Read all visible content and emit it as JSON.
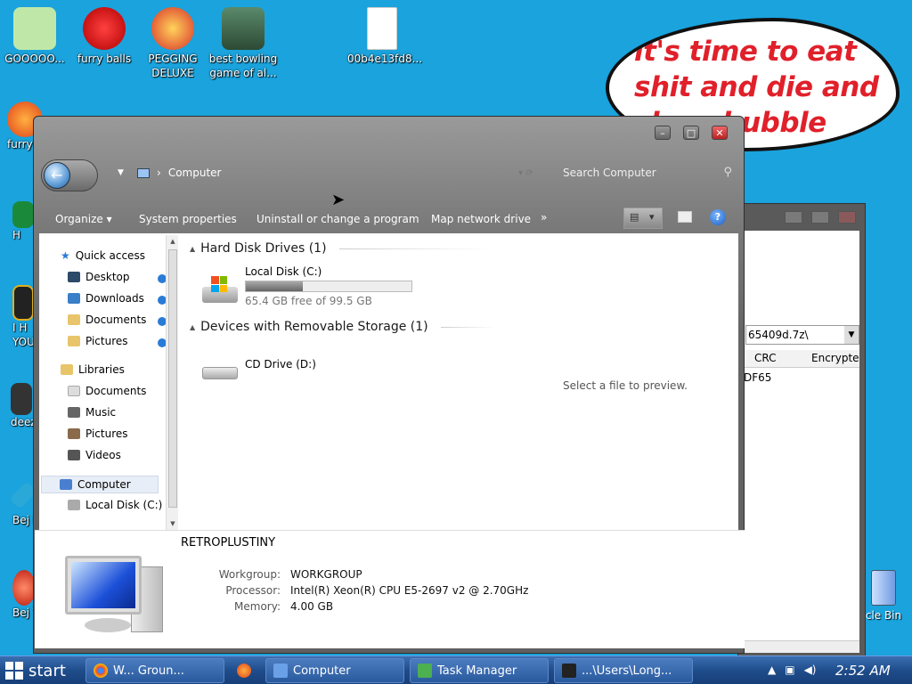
{
  "desktop": {
    "icons": [
      {
        "label": "GOOOOO...",
        "color": "#bfe8a8"
      },
      {
        "label": "furry balls",
        "color": "#e02020"
      },
      {
        "label": "PEGGING DELUXE",
        "color": "#d8302a"
      },
      {
        "label": "best bowling game of al...",
        "color": "#3d6a4a"
      },
      {
        "label": "00b4e13fd8...",
        "color": "#ffffff"
      },
      {
        "label": "furry",
        "color": "#f06a1f"
      },
      {
        "label": "H",
        "color": "#1a8a3a"
      },
      {
        "label": "I H YOU",
        "color": "#222222"
      },
      {
        "label": "deez",
        "color": "#333333"
      },
      {
        "label": "Bej De",
        "color": "#2aa8d8"
      },
      {
        "label": "Bej Tw",
        "color": "#d83020"
      },
      {
        "label": "cle Bin",
        "color": "#9bbcf0"
      }
    ],
    "bubble_text": "it's time to eat shit and die and chew bubble gum"
  },
  "bg_window": {
    "path": "65409d.7z\\",
    "columns": [
      "CRC",
      "Encrypte"
    ],
    "row_crc": "DF65"
  },
  "explorer": {
    "address": "Computer",
    "search_placeholder": "Search Computer",
    "toolbar": {
      "organize": "Organize",
      "system_properties": "System properties",
      "uninstall": "Uninstall or change a program",
      "map_network": "Map network drive",
      "more": "»"
    },
    "nav": {
      "quick_access": "Quick access",
      "desktop": "Desktop",
      "downloads": "Downloads",
      "documents": "Documents",
      "pictures": "Pictures",
      "libraries": "Libraries",
      "lib_documents": "Documents",
      "lib_music": "Music",
      "lib_pictures": "Pictures",
      "lib_videos": "Videos",
      "computer": "Computer",
      "local_disk": "Local Disk (C:)"
    },
    "groups": {
      "hdd": "Hard Disk Drives (1)",
      "removable": "Devices with Removable Storage (1)"
    },
    "drives": {
      "c_name": "Local Disk (C:)",
      "c_free": "65.4 GB free of 99.5 GB",
      "c_used_fraction": 0.343,
      "d_name": "CD Drive (D:)"
    },
    "preview": "Select a file to preview.",
    "details": {
      "hostname": "RETROPLUSTINY",
      "workgroup_label": "Workgroup:",
      "workgroup": "WORKGROUP",
      "processor_label": "Processor:",
      "processor": "Intel(R) Xeon(R) CPU E5-2697 v2 @ 2.70GHz",
      "memory_label": "Memory:",
      "memory": "4.00 GB"
    }
  },
  "taskbar": {
    "start": "start",
    "buttons": [
      {
        "label": "W... Groun...",
        "color": "#e8a020"
      },
      {
        "label": "Computer",
        "color": "#6aa0e8"
      },
      {
        "label": "Task Manager",
        "color": "#4caf50"
      },
      {
        "label": "...\\Users\\Long...",
        "color": "#222222"
      }
    ],
    "clock": "2:52 AM"
  }
}
